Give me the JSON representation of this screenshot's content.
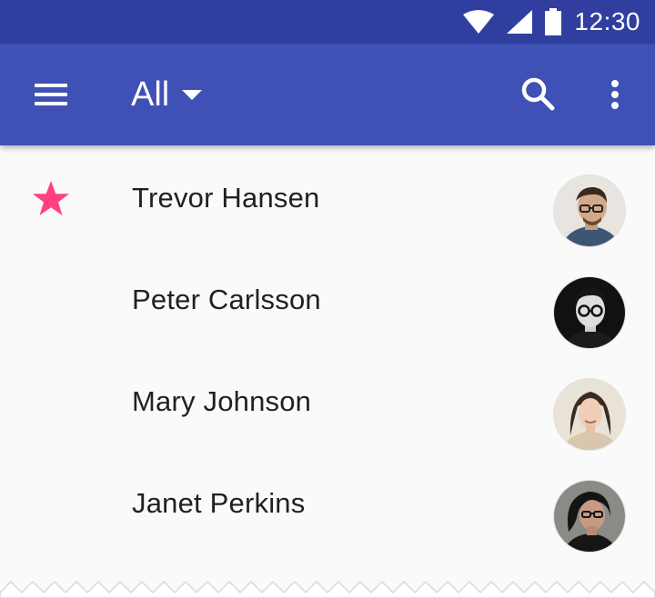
{
  "status_bar": {
    "time": "12:30",
    "icons": [
      "wifi-icon",
      "cell-signal-icon",
      "battery-icon"
    ]
  },
  "app_bar": {
    "menu_icon": "menu-icon",
    "filter": {
      "selected": "All"
    },
    "actions": [
      "search-icon",
      "more-vert-icon"
    ],
    "colors": {
      "primary": "#3f51b5",
      "primary_dark": "#303f9f"
    }
  },
  "contacts": [
    {
      "name": "Trevor Hansen",
      "starred": true,
      "avatar": "avatar-trevor"
    },
    {
      "name": "Peter Carlsson",
      "starred": false,
      "avatar": "avatar-peter"
    },
    {
      "name": "Mary Johnson",
      "starred": false,
      "avatar": "avatar-mary"
    },
    {
      "name": "Janet Perkins",
      "starred": false,
      "avatar": "avatar-janet"
    }
  ],
  "accent_color": "#ff4081"
}
